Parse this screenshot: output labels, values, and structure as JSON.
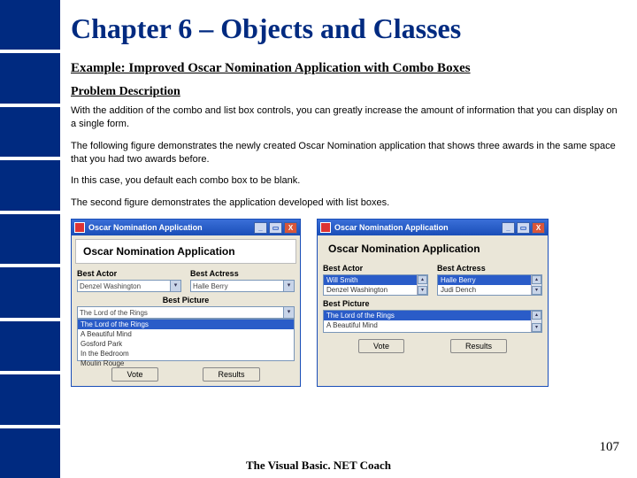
{
  "chapter_title": "Chapter 6 – Objects and Classes",
  "subtitle": "Example: Improved Oscar Nomination Application with Combo Boxes",
  "section_head": "Problem Description",
  "paragraphs": {
    "p0": "With the addition of the combo and list box controls, you can greatly increase the amount of information that you can display on a single form.",
    "p1": "The following figure demonstrates the newly created Oscar Nomination application that shows three awards in the same space that you had two awards before.",
    "p2": "In this case, you default each combo box to be blank.",
    "p3": "The second figure demonstrates the application developed with list boxes."
  },
  "figA": {
    "window_title": "Oscar Nomination Application",
    "heading": "Oscar Nomination Application",
    "best_actor_label": "Best Actor",
    "best_actor_value": "Denzel Washington",
    "best_actress_label": "Best Actress",
    "best_actress_value": "Halle Berry",
    "best_picture_label": "Best Picture",
    "pic0": "The Lord of the Rings",
    "pic1": "A Beautiful Mind",
    "pic2": "Gosford Park",
    "pic3": "In the Bedroom",
    "pic4": "Moulin Rouge",
    "vote": "Vote",
    "results": "Results"
  },
  "figB": {
    "window_title": "Oscar Nomination Application",
    "heading": "Oscar Nomination Application",
    "best_actor_label": "Best Actor",
    "actor0": "Will Smith",
    "actor1": "Denzel Washington",
    "best_actress_label": "Best Actress",
    "actress0": "Halle Berry",
    "actress1": "Judi Dench",
    "best_picture_label": "Best Picture",
    "pic0": "The Lord of the Rings",
    "pic1": "A Beautiful Mind",
    "vote": "Vote",
    "results": "Results"
  },
  "page_number": "107",
  "footer": "The Visual Basic. NET Coach"
}
